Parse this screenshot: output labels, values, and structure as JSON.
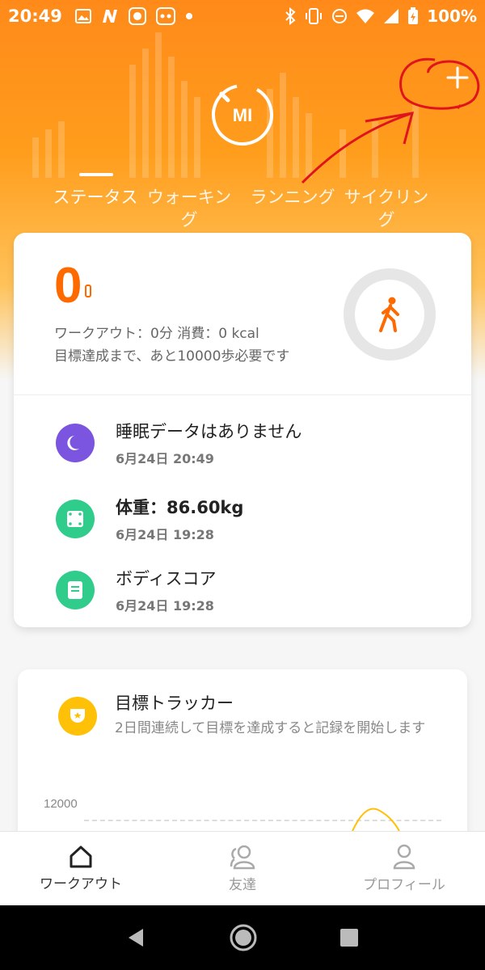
{
  "status_bar": {
    "time": "20:49",
    "battery": "100%",
    "left_icons": [
      "image-icon",
      "n-icon",
      "app-icon",
      "raccoon-icon",
      "dot-icon"
    ],
    "right_icons": [
      "bluetooth-icon",
      "vibrate-icon",
      "dnd-icon",
      "wifi-icon",
      "signal-icon",
      "battery-charging-icon"
    ]
  },
  "header": {
    "logo": "MI",
    "plus_label": "+"
  },
  "tabs": [
    {
      "label": "ステータス",
      "active": true
    },
    {
      "label": "ウォーキング",
      "active": false
    },
    {
      "label": "ランニング",
      "active": false
    },
    {
      "label": "サイクリング",
      "active": false
    }
  ],
  "summary": {
    "steps": "0",
    "workout_line": "ワークアウト：0分 消費：0 kcal",
    "goal_line": "目標達成まで、あと10000歩必要です"
  },
  "items": [
    {
      "title": "睡眠データはありません",
      "sub": "6月24日 20:49",
      "icon": "sleep-moon-icon",
      "color": "#7b55e0"
    },
    {
      "title": "体重：86.60kg",
      "sub": "6月24日 19:28",
      "icon": "scale-icon",
      "color": "#2fcc8b"
    },
    {
      "title": "ボディスコア",
      "sub": "6月24日 19:28",
      "icon": "body-score-icon",
      "color": "#2fcc8b"
    }
  ],
  "tracker": {
    "title": "目標トラッカー",
    "desc": "2日間連続して目標を達成すると記録を開始します",
    "chart_max": "12000"
  },
  "bottom_nav": [
    {
      "label": "ワークアウト",
      "icon": "home-icon",
      "active": true
    },
    {
      "label": "友達",
      "icon": "friends-icon",
      "active": false
    },
    {
      "label": "プロフィール",
      "icon": "profile-icon",
      "active": false
    }
  ],
  "colors": {
    "accent": "#ff7a00",
    "annotation": "#e0141e"
  }
}
